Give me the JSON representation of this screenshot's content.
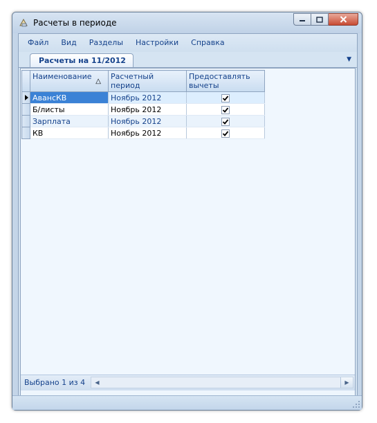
{
  "window": {
    "title": "Расчеты в периоде",
    "controls": [
      "minimize-button",
      "maximize-button",
      "close-button"
    ]
  },
  "menu": {
    "items": [
      "Файл",
      "Вид",
      "Разделы",
      "Настройки",
      "Справка"
    ]
  },
  "tabs": [
    {
      "label": "Расчеты на 11/2012",
      "active": true
    }
  ],
  "grid": {
    "columns": [
      "Наименование",
      "Расчетный период",
      "Предоставлять вычеты"
    ],
    "sorted_column": "Наименование",
    "sort_direction": "ascending",
    "rows": [
      {
        "name": "АвансКВ",
        "period": "Ноябрь 2012",
        "deductions": true,
        "selected": true
      },
      {
        "name": "Б/листы",
        "period": "Ноябрь 2012",
        "deductions": true
      },
      {
        "name": "Зарплата",
        "period": "Ноябрь 2012",
        "deductions": true
      },
      {
        "name": "КВ",
        "period": "Ноябрь 2012",
        "deductions": true
      }
    ]
  },
  "status": {
    "selection_text": "Выбрано 1 из 4"
  },
  "colors": {
    "accent_text": "#15428b",
    "selected_cell": "#3b82d6",
    "frame": "#c4d5e8"
  }
}
